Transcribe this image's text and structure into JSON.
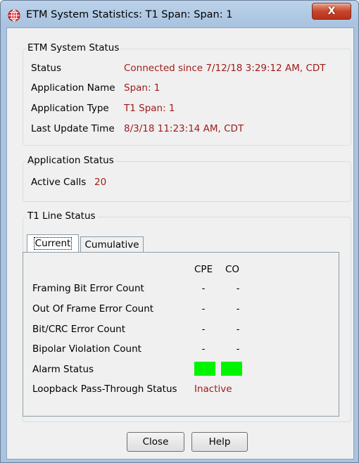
{
  "window": {
    "title": "ETM System Statistics:  T1 Span: Span: 1",
    "icon": "globe-grid-icon",
    "close_icon": "close-icon",
    "close_glyph": "X",
    "title_color": "#bcd2ea"
  },
  "etm_system_status": {
    "legend": "ETM System Status",
    "rows": [
      {
        "label": "Status",
        "value": "Connected since 7/12/18 3:29:12 AM, CDT"
      },
      {
        "label": "Application Name",
        "value": "Span: 1"
      },
      {
        "label": "Application Type",
        "value": "T1 Span: 1"
      },
      {
        "label": "Last Update Time",
        "value": "8/3/18 11:23:14 AM, CDT"
      }
    ]
  },
  "application_status": {
    "legend": "Application Status",
    "active_calls_label": "Active Calls",
    "active_calls_value": "20"
  },
  "t1_line_status": {
    "legend": "T1 Line Status",
    "tabs": [
      {
        "label": "Current",
        "active": true
      },
      {
        "label": "Cumulative",
        "active": false
      }
    ],
    "columns": [
      "CPE",
      "CO"
    ],
    "rows": [
      {
        "label": "Framing Bit Error Count",
        "cpe": "-",
        "co": "-"
      },
      {
        "label": "Out Of Frame Error Count",
        "cpe": "-",
        "co": "-"
      },
      {
        "label": "Bit/CRC Error Count",
        "cpe": "-",
        "co": "-"
      },
      {
        "label": "Bipolar Violation Count",
        "cpe": "-",
        "co": "-"
      }
    ],
    "alarm_status_label": "Alarm Status",
    "alarm_colors": {
      "cpe": "#00f400",
      "co": "#00f400"
    },
    "loopback_label": "Loopback Pass-Through Status",
    "loopback_value": "Inactive"
  },
  "buttons": {
    "close": "Close",
    "help": "Help"
  },
  "colors": {
    "value_text": "#a01c1c",
    "alarm_ok": "#00f400"
  }
}
